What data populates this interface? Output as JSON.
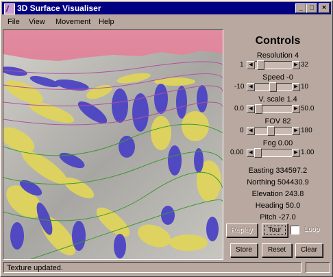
{
  "window": {
    "title": "3D Surface Visualiser"
  },
  "menubar": {
    "items": [
      "File",
      "View",
      "Movement",
      "Help"
    ]
  },
  "controls": {
    "heading": "Controls",
    "sliders": [
      {
        "label": "Resolution 4",
        "min": "1",
        "max": "32",
        "level": 0.1
      },
      {
        "label": "Speed -0",
        "min": "-10",
        "max": "10",
        "level": 0.5
      },
      {
        "label": "V. scale 1.4",
        "min": "0.0",
        "max": "50.0",
        "level": 0.03
      },
      {
        "label": "FOV 82",
        "min": "0",
        "max": "180",
        "level": 0.45
      },
      {
        "label": "Fog 0.00",
        "min": "0.00",
        "max": "1.00",
        "level": 0.0
      }
    ],
    "readouts": {
      "easting": "Easting 334597.2",
      "northing": "Northing 504430.9",
      "elevation": "Elevation 243.8",
      "heading": "Heading 50.0",
      "pitch": "Pitch -27.0"
    },
    "buttons": {
      "replay": "Replay",
      "tour": "Tour",
      "loop": "Loop",
      "store": "Store",
      "reset": "Reset",
      "clear": "Clear"
    }
  },
  "status": {
    "text": "Texture updated."
  },
  "colors": {
    "titlebar": "#000080",
    "sky": "#d87890",
    "terrain_yellow": "#e0d060",
    "terrain_blue": "#4840c0"
  }
}
